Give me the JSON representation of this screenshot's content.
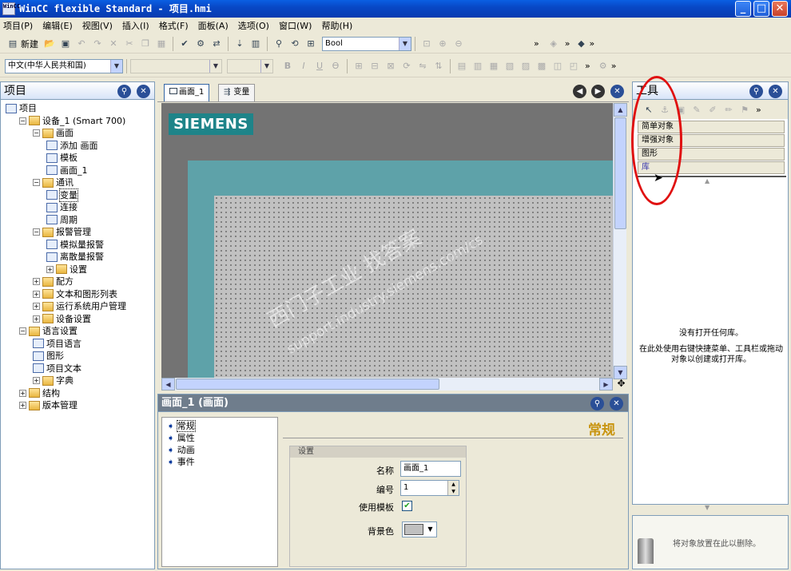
{
  "window": {
    "title": "WinCC flexible Standard - 项目.hmi",
    "logo_text": "WinCC",
    "minimize_label": "_",
    "maximize_label": "□",
    "close_label": "✕"
  },
  "menubar": [
    "项目(P)",
    "编辑(E)",
    "视图(V)",
    "插入(I)",
    "格式(F)",
    "面板(A)",
    "选项(O)",
    "窗口(W)",
    "帮助(H)"
  ],
  "toolbar1": {
    "new_label": "新建",
    "type_combo_value": "Bool",
    "overflow": "»"
  },
  "toolbar2": {
    "language_combo_value": "中文(中华人民共和国)",
    "font_combo_value": "",
    "size_combo_value": "",
    "bold": "B",
    "italic": "I",
    "underline": "U"
  },
  "project_panel": {
    "title": "项目",
    "pin_icon": "pin-icon",
    "items": [
      {
        "label": "项目",
        "level": 0,
        "exp": ""
      },
      {
        "label": "设备_1 (Smart 700)",
        "level": 1,
        "exp": "−"
      },
      {
        "label": "画面",
        "level": 2,
        "exp": "−"
      },
      {
        "label": "添加 画面",
        "level": 3,
        "exp": ""
      },
      {
        "label": "模板",
        "level": 3,
        "exp": ""
      },
      {
        "label": "画面_1",
        "level": 3,
        "exp": ""
      },
      {
        "label": "通讯",
        "level": 2,
        "exp": "−"
      },
      {
        "label": "变量",
        "level": 3,
        "exp": ""
      },
      {
        "label": "连接",
        "level": 3,
        "exp": ""
      },
      {
        "label": "周期",
        "level": 3,
        "exp": ""
      },
      {
        "label": "报警管理",
        "level": 2,
        "exp": "−"
      },
      {
        "label": "模拟量报警",
        "level": 3,
        "exp": ""
      },
      {
        "label": "离散量报警",
        "level": 3,
        "exp": ""
      },
      {
        "label": "设置",
        "level": 3,
        "exp": "+"
      },
      {
        "label": "配方",
        "level": 2,
        "exp": "+"
      },
      {
        "label": "文本和图形列表",
        "level": 2,
        "exp": "+"
      },
      {
        "label": "运行系统用户管理",
        "level": 2,
        "exp": "+"
      },
      {
        "label": "设备设置",
        "level": 2,
        "exp": "+"
      },
      {
        "label": "语言设置",
        "level": 1,
        "exp": "−"
      },
      {
        "label": "项目语言",
        "level": 2,
        "exp": ""
      },
      {
        "label": "图形",
        "level": 2,
        "exp": ""
      },
      {
        "label": "项目文本",
        "level": 2,
        "exp": ""
      },
      {
        "label": "字典",
        "level": 2,
        "exp": "+"
      },
      {
        "label": "结构",
        "level": 1,
        "exp": "+"
      },
      {
        "label": "版本管理",
        "level": 1,
        "exp": "+"
      }
    ]
  },
  "editor": {
    "tabs": [
      "画面_1",
      "变量"
    ],
    "brand": "SIEMENS",
    "watermark_line1": "西门子工业  找答案",
    "watermark_line2": "support.industry.siemens.com/cs"
  },
  "tools_panel": {
    "title": "工具",
    "groups": [
      "简单对象",
      "增强对象",
      "图形",
      "库"
    ],
    "empty_title": "没有打开任何库。",
    "empty_hint": "在此处使用右键快捷菜单、工具栏或拖动对象以创建或打开库。",
    "delete_hint": "将对象放置在此以删除。"
  },
  "properties": {
    "title": "画面_1 (画面)",
    "nav": [
      "常规",
      "属性",
      "动画",
      "事件"
    ],
    "section_title": "常规",
    "group_title": "设置",
    "name_label": "名称",
    "name_value": "画面_1",
    "number_label": "编号",
    "number_value": "1",
    "template_label": "使用模板",
    "template_checked": true,
    "bgcolor_label": "背景色",
    "bgcolor_value": "#c0c0c0"
  },
  "colors": {
    "xp_blue": "#0a5fe3",
    "siemens_teal": "#1e8489",
    "annotation_red": "#e01010"
  }
}
